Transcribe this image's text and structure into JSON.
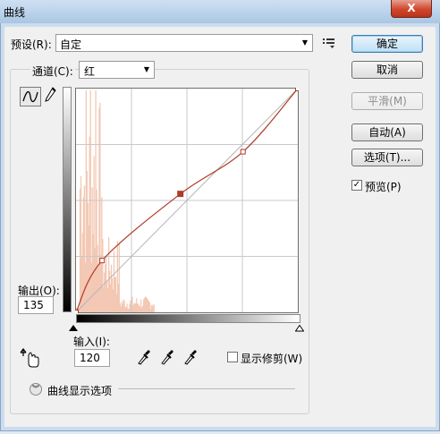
{
  "window": {
    "title": "曲线",
    "close_glyph": "X"
  },
  "preset": {
    "label": "预设(R):",
    "value": "自定",
    "options_icon": "preset-options-icon"
  },
  "channel": {
    "label": "通道(C):",
    "value": "红"
  },
  "buttons": {
    "ok": "确定",
    "cancel": "取消",
    "smooth": "平滑(M)",
    "auto": "自动(A)",
    "options": "选项(T)..."
  },
  "preview": {
    "label": "预览(P)",
    "checked": true
  },
  "output": {
    "label": "输出(O):",
    "value": "135"
  },
  "input": {
    "label": "输入(I):",
    "value": "120"
  },
  "show_clipping": {
    "label": "显示修剪(W)",
    "checked": false
  },
  "curve_display_options": {
    "label": "曲线显示选项"
  },
  "curve": {
    "channel_color": "#b03a26",
    "histogram_color": "#f3c8b4",
    "points": [
      [
        0,
        0
      ],
      [
        30,
        59
      ],
      [
        120,
        135
      ],
      [
        192,
        183
      ],
      [
        255,
        255
      ]
    ],
    "selected_point": [
      120,
      135
    ]
  },
  "icons": [
    "curve-tool-icon",
    "pencil-icon",
    "target-adjust-icon",
    "black-eyedropper-icon",
    "gray-eyedropper-icon",
    "white-eyedropper-icon",
    "expand-chevron-icon"
  ]
}
